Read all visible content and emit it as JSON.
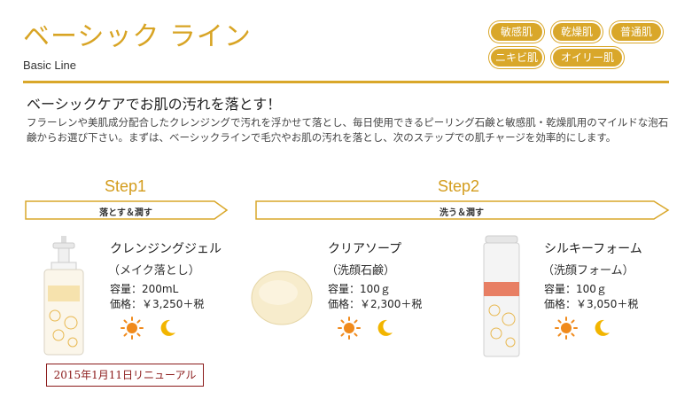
{
  "header": {
    "title": "ベーシック ライン",
    "subtitle": "Basic Line"
  },
  "skin_tags": [
    "敏感肌",
    "乾燥肌",
    "普通肌",
    "ニキビ肌",
    "オイリー肌"
  ],
  "intro": {
    "headline": "ベーシックケアでお肌の汚れを落とす！",
    "description": "フラーレンや美肌成分配合したクレンジングで汚れを浮かせて落とし、毎日使用できるピーリング石鹸と敏感肌・乾燥肌用のマイルドな泡石鹸からお選び下さい。まずは、ベーシックラインで毛穴やお肌の汚れを落とし、次のステップでの肌チャージを効率的にします。"
  },
  "steps": [
    {
      "label": "Step1",
      "banner": "落とす＆潤す"
    },
    {
      "label": "Step2",
      "banner": "洗う＆潤す"
    }
  ],
  "products": [
    {
      "name": "クレンジングジェル",
      "sub": "（メイク落とし）",
      "capacity": "容量：200mL",
      "price": "価格：￥3,250＋税",
      "icons": [
        "sun-icon",
        "moon-icon"
      ]
    },
    {
      "name": "クリアソープ",
      "sub": "（洗顔石鹸）",
      "capacity": "容量：100ｇ",
      "price": "価格：￥2,300＋税",
      "icons": [
        "sun-icon",
        "moon-icon"
      ]
    },
    {
      "name": "シルキーフォーム",
      "sub": "（洗顔フォーム）",
      "capacity": "容量：100ｇ",
      "price": "価格：￥3,050＋税",
      "icons": [
        "sun-icon",
        "moon-icon"
      ]
    }
  ],
  "renewal_note": "2015年1月11日リニューアル",
  "colors": {
    "accent": "#d9a72a",
    "renewal": "#8b1a1a",
    "sun": "#f08a1c",
    "moon": "#f2b500"
  }
}
